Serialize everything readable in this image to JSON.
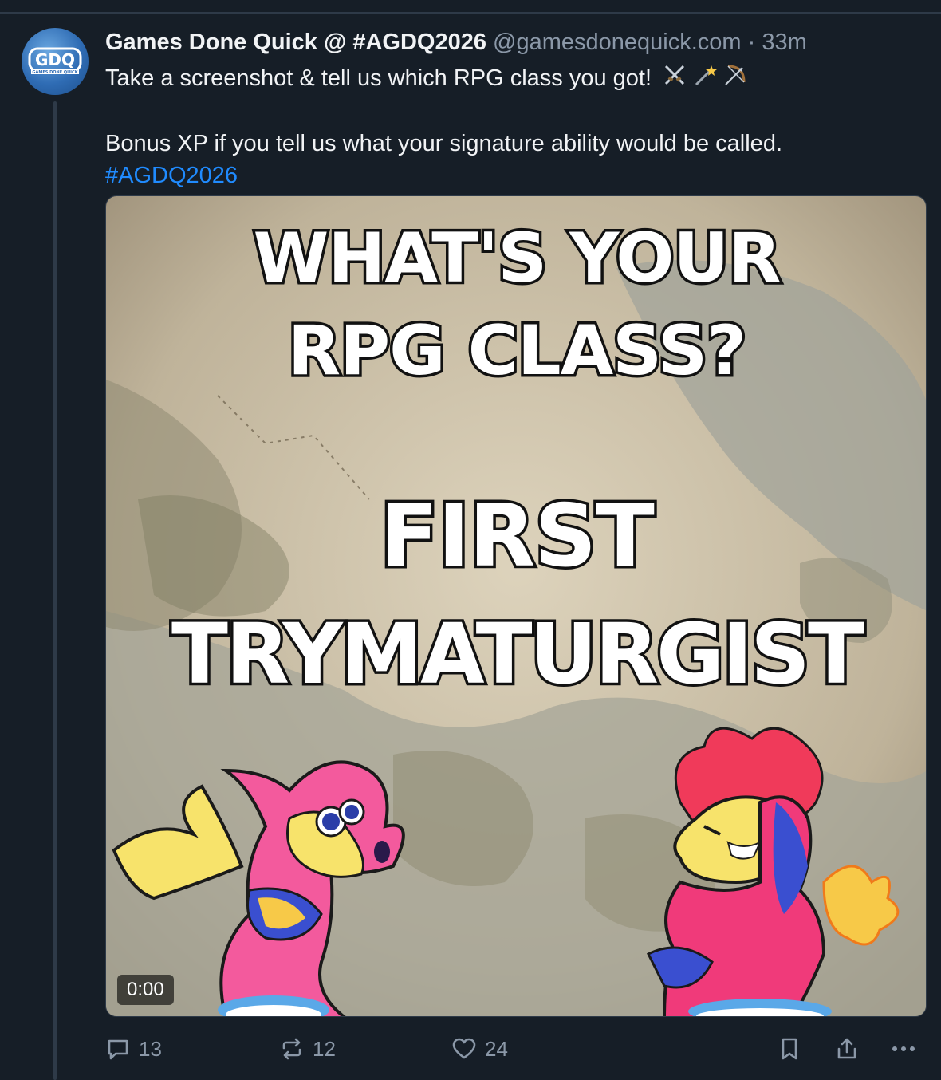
{
  "post": {
    "author": "Games Done Quick @ #AGDQ2026",
    "handle": "@gamesdonequick.com",
    "separator": "·",
    "time": "33m",
    "text_line1": "Take a screenshot & tell us which RPG class you got!",
    "emojis": [
      "crossed-swords-icon",
      "magic-wand-icon",
      "bow-and-arrow-icon"
    ],
    "text_line2": "Bonus XP if you tell us what your signature ability would be called.",
    "hashtag": "#AGDQ2026"
  },
  "avatar": {
    "logo_text": "GDQ",
    "logo_subtext": "GAMES DONE QUICK"
  },
  "media": {
    "line1": "WHAT'S YOUR",
    "line2": "RPG CLASS?",
    "line3": "FIRST",
    "line4": "TRYMATURGIST",
    "timecode": "0:00"
  },
  "actions": {
    "replies": "13",
    "reposts": "12",
    "likes": "24"
  },
  "colors": {
    "background": "#161e27",
    "link": "#208bfe",
    "muted": "#8b98a8",
    "border": "#2e3a48"
  }
}
